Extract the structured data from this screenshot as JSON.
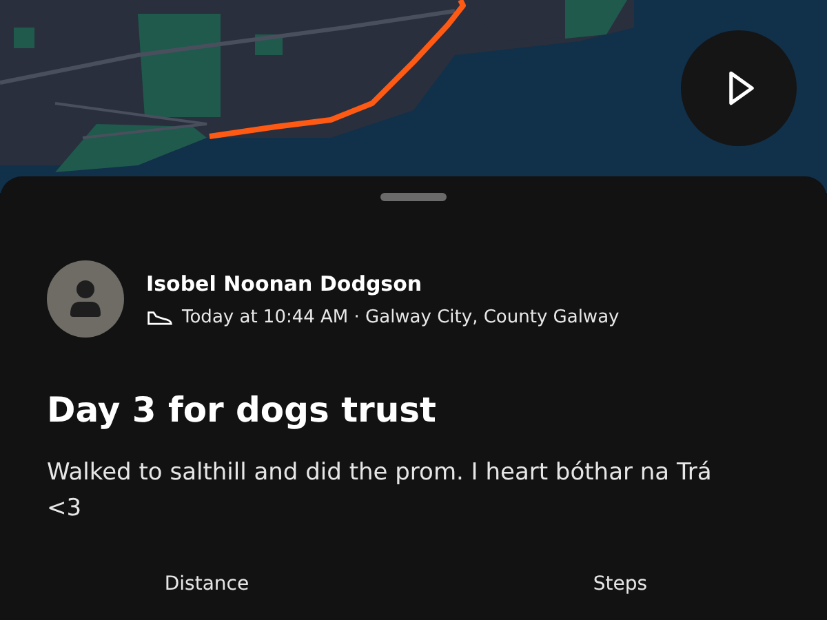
{
  "post": {
    "author": "Isobel Noonan Dodgson",
    "meta": "Today at 10:44 AM · Galway City, County Galway",
    "title": "Day 3 for dogs trust",
    "body": "Walked to salthill and did the prom. I heart bóthar na Trá <3"
  },
  "stats": [
    {
      "label": "Distance"
    },
    {
      "label": "Steps"
    }
  ]
}
